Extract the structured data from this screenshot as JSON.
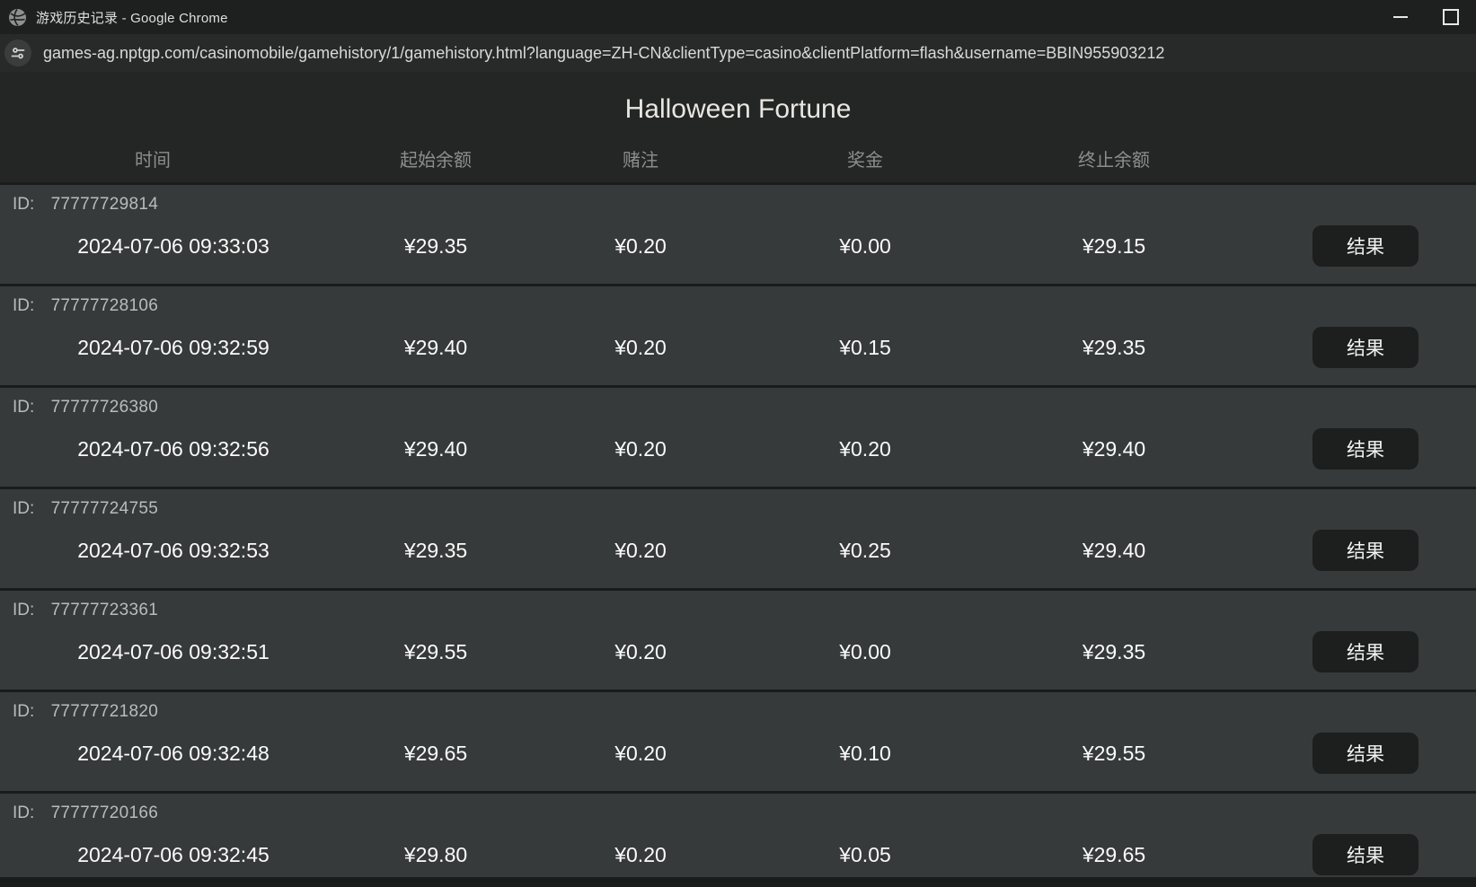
{
  "window": {
    "title": "游戏历史记录 - Google Chrome"
  },
  "urlbar": {
    "url": "games-ag.nptgp.com/casinomobile/gamehistory/1/gamehistory.html?language=ZH-CN&clientType=casino&clientPlatform=flash&username=BBIN955903212"
  },
  "page": {
    "title": "Halloween Fortune",
    "columns": [
      "时间",
      "起始余额",
      "赌注",
      "奖金",
      "终止余额"
    ],
    "id_prefix": "ID:",
    "result_button_label": "结果",
    "rows": [
      {
        "id": "77777729814",
        "time": "2024-07-06 09:33:03",
        "start": "¥29.35",
        "bet": "¥0.20",
        "win": "¥0.00",
        "end": "¥29.15"
      },
      {
        "id": "77777728106",
        "time": "2024-07-06 09:32:59",
        "start": "¥29.40",
        "bet": "¥0.20",
        "win": "¥0.15",
        "end": "¥29.35"
      },
      {
        "id": "77777726380",
        "time": "2024-07-06 09:32:56",
        "start": "¥29.40",
        "bet": "¥0.20",
        "win": "¥0.20",
        "end": "¥29.40"
      },
      {
        "id": "77777724755",
        "time": "2024-07-06 09:32:53",
        "start": "¥29.35",
        "bet": "¥0.20",
        "win": "¥0.25",
        "end": "¥29.40"
      },
      {
        "id": "77777723361",
        "time": "2024-07-06 09:32:51",
        "start": "¥29.55",
        "bet": "¥0.20",
        "win": "¥0.00",
        "end": "¥29.35"
      },
      {
        "id": "77777721820",
        "time": "2024-07-06 09:32:48",
        "start": "¥29.65",
        "bet": "¥0.20",
        "win": "¥0.10",
        "end": "¥29.55"
      },
      {
        "id": "77777720166",
        "time": "2024-07-06 09:32:45",
        "start": "¥29.80",
        "bet": "¥0.20",
        "win": "¥0.05",
        "end": "¥29.65"
      }
    ],
    "colors": {
      "titlebar_bg": "#1e1f1f",
      "urlbar_bg": "#282a2a",
      "page_bg": "#242626",
      "row_bg": "#373a3a",
      "divider": "#1a1c1c",
      "button_bg": "#1d1e1e",
      "text_primary": "#fbfbfa",
      "text_secondary": "#b9bcbb",
      "text_header": "#8b8e8d"
    }
  }
}
